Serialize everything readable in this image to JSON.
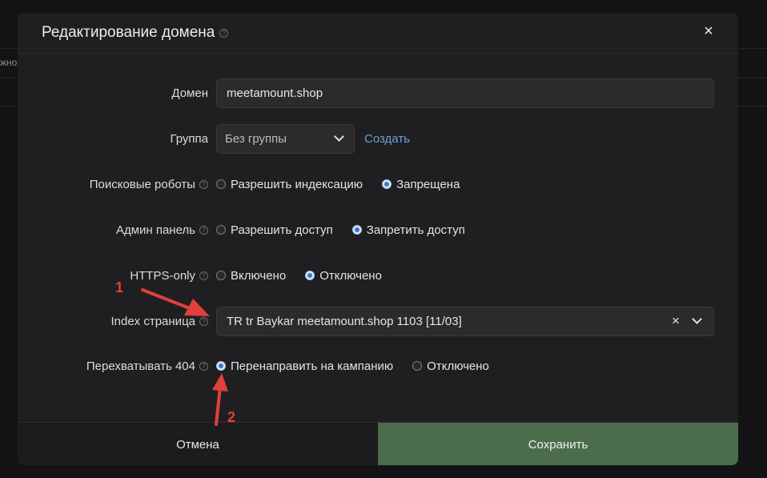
{
  "background": {
    "cell_text": "жно"
  },
  "modal": {
    "title": "Редактирование домена",
    "close_symbol": "×",
    "help_symbol": "?"
  },
  "form": {
    "domain": {
      "label": "Домен",
      "value": "meetamount.shop"
    },
    "group": {
      "label": "Группа",
      "value": "Без группы",
      "create_link": "Создать"
    },
    "robots": {
      "label": "Поисковые роботы",
      "options": [
        "Разрешить индексацию",
        "Запрещена"
      ],
      "selected": "Запрещена"
    },
    "admin": {
      "label": "Админ панель",
      "options": [
        "Разрешить доступ",
        "Запретить доступ"
      ],
      "selected": "Запретить доступ"
    },
    "https": {
      "label": "HTTPS-only",
      "options": [
        "Включено",
        "Отключено"
      ],
      "selected": "Отключено"
    },
    "index_page": {
      "label": "Index страница",
      "value": "TR tr Baykar meetamount.shop 1103 [11/03]",
      "clear_symbol": "×"
    },
    "intercept404": {
      "label": "Перехватывать 404",
      "options": [
        "Перенаправить на кампанию",
        "Отключено"
      ],
      "selected": "Перенаправить на кампанию"
    }
  },
  "footer": {
    "cancel_label": "Отмена",
    "save_label": "Сохранить"
  },
  "annotations": [
    {
      "number": "1"
    },
    {
      "number": "2"
    }
  ],
  "colors": {
    "accent_blue": "#3d79c9",
    "save_green": "#4b6d4b",
    "link_blue": "#6f9fd1",
    "annotation_red": "#e2403a"
  }
}
